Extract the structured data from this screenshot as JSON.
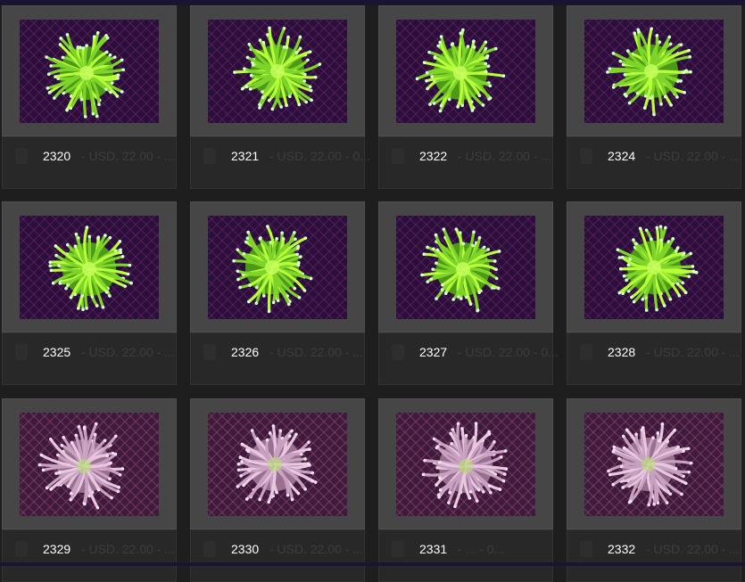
{
  "items": [
    {
      "number": "2320",
      "price": "- USD. 22.00 - ...",
      "variant": "green"
    },
    {
      "number": "2321",
      "price": "- USD. 22.00 - 0...",
      "variant": "green"
    },
    {
      "number": "2322",
      "price": "- USD. 22.00 - ...",
      "variant": "green"
    },
    {
      "number": "2324",
      "price": "- USD. 22.00 - ...",
      "variant": "green"
    },
    {
      "number": "2325",
      "price": "- USD. 22.00 - ...",
      "variant": "green"
    },
    {
      "number": "2326",
      "price": "- USD. 22.00 - ...",
      "variant": "green"
    },
    {
      "number": "2327",
      "price": "- USD. 22.00 - 0...",
      "variant": "green"
    },
    {
      "number": "2328",
      "price": "- USD. 22.00 - ...",
      "variant": "green"
    },
    {
      "number": "2329",
      "price": "- USD. 22.00 - ...",
      "variant": "pink"
    },
    {
      "number": "2330",
      "price": "- USD. 22.00 - ...",
      "variant": "pink"
    },
    {
      "number": "2331",
      "price": "- ...   - 0...",
      "variant": "pink"
    },
    {
      "number": "2332",
      "price": "- USD. 22.00 - ...",
      "variant": "pink"
    }
  ],
  "colors": {
    "background": "#1e1e1e",
    "frame": "#1a1433",
    "card": "#262626",
    "thumb_border": "#464646",
    "text": "#ffffff",
    "muted": "#3d3d3d",
    "green_coral": "#8ee02a",
    "pink_coral": "#c9a0c8",
    "tank_purple": "#3a1450"
  },
  "icons": [
    "coral-photo",
    "cart-icon"
  ]
}
